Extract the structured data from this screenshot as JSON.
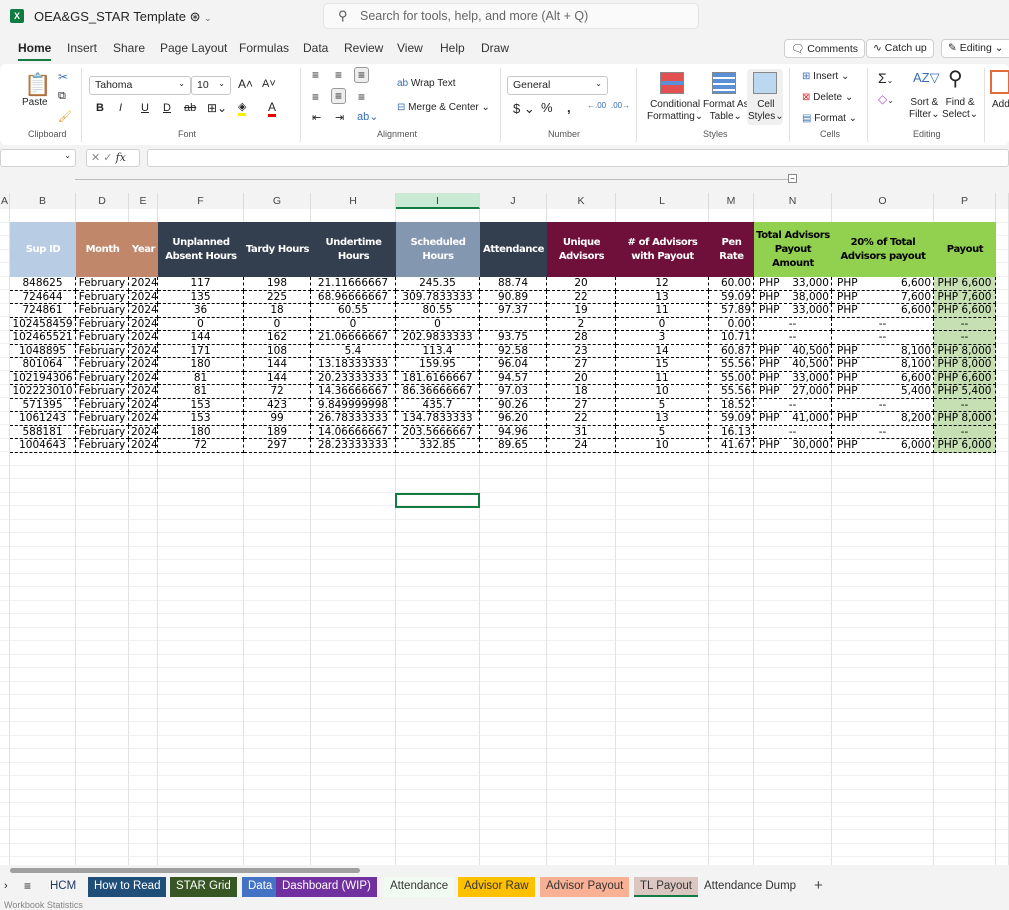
{
  "app": {
    "doc_title": "OEA&GS_STAR Template",
    "search_placeholder": "Search for tools, help, and more (Alt + Q)"
  },
  "menu_tabs": [
    "Home",
    "Insert",
    "Share",
    "Page Layout",
    "Formulas",
    "Data",
    "Review",
    "View",
    "Help",
    "Draw"
  ],
  "top_buttons": {
    "comments": "Comments",
    "catch_up": "Catch up",
    "editing": "Editing"
  },
  "ribbon": {
    "paste": "Paste",
    "clipboard": "Clipboard",
    "font_name": "Tahoma",
    "font_size": "10",
    "font": "Font",
    "wrap_text": "Wrap Text",
    "merge_center": "Merge & Center",
    "alignment": "Alignment",
    "number_format": "General",
    "number": "Number",
    "conditional": "Conditional",
    "formatting": "Formatting",
    "format_as": "Format As",
    "table": "Table",
    "cell": "Cell",
    "styles_btn": "Styles",
    "styles": "Styles",
    "insert": "Insert",
    "delete": "Delete",
    "format": "Format",
    "cells": "Cells",
    "sort": "Sort &",
    "filter": "Filter",
    "find": "Find &",
    "select": "Select",
    "editing": "Editing",
    "add": "Add"
  },
  "formula_bar": {
    "fx": "fx",
    "value": ""
  },
  "columns": [
    "A",
    "B",
    "D",
    "E",
    "F",
    "G",
    "H",
    "I",
    "J",
    "K",
    "L",
    "M",
    "N",
    "O",
    "P"
  ],
  "headers": [
    "Sup ID",
    "Month",
    "Year",
    "Unplanned Absent Hours",
    "Tardy Hours",
    "Undertime Hours",
    "Scheduled Hours",
    "Attendance",
    "Unique Advisors",
    "# of Advisors with Payout",
    "Pen Rate",
    "Total Advisors Payout Amount",
    "20% of Total Advisors payout",
    "Payout"
  ],
  "header_colors": [
    "#b8cce4",
    "#c0876a",
    "#c0876a",
    "#333f4f",
    "#333f4f",
    "#333f4f",
    "#8497b0",
    "#333f4f",
    "#6e1039",
    "#6e1039",
    "#6e1039",
    "#92d050",
    "#92d050",
    "#92d050"
  ],
  "rows": [
    [
      "848625",
      "February",
      "2024",
      "117",
      "198",
      "21.11666667",
      "245.35",
      "88.74",
      "20",
      "12",
      "60.00",
      "33,000",
      "6,600",
      "PHP 6,600"
    ],
    [
      "724644",
      "February",
      "2024",
      "135",
      "225",
      "68.96666667",
      "309.7833333",
      "90.89",
      "22",
      "13",
      "59.09",
      "38,000",
      "7,600",
      "PHP 7,600"
    ],
    [
      "724861",
      "February",
      "2024",
      "36",
      "18",
      "60.55",
      "80.55",
      "97.37",
      "19",
      "11",
      "57.89",
      "33,000",
      "6,600",
      "PHP 6,600"
    ],
    [
      "102458459",
      "February",
      "2024",
      "0",
      "0",
      "0",
      "0",
      "",
      "2",
      "0",
      "0.00",
      "--",
      "--",
      "--"
    ],
    [
      "102465521",
      "February",
      "2024",
      "144",
      "162",
      "21.06666667",
      "202.9833333",
      "93.75",
      "28",
      "3",
      "10.71",
      "--",
      "--",
      "--"
    ],
    [
      "1048895",
      "February",
      "2024",
      "171",
      "108",
      "5.4",
      "113.4",
      "92.58",
      "23",
      "14",
      "60.87",
      "40,500",
      "8,100",
      "PHP 8,000"
    ],
    [
      "801064",
      "February",
      "2024",
      "180",
      "144",
      "13.18333333",
      "159.95",
      "96.04",
      "27",
      "15",
      "55.56",
      "40,500",
      "8,100",
      "PHP 8,000"
    ],
    [
      "102194306",
      "February",
      "2024",
      "81",
      "144",
      "20.23333333",
      "181.6166667",
      "94.57",
      "20",
      "11",
      "55.00",
      "33,000",
      "6,600",
      "PHP 6,600"
    ],
    [
      "102223010",
      "February",
      "2024",
      "81",
      "72",
      "14.36666667",
      "86.36666667",
      "97.03",
      "18",
      "10",
      "55.56",
      "27,000",
      "5,400",
      "PHP 5,400"
    ],
    [
      "571395",
      "February",
      "2024",
      "153",
      "423",
      "9.849999998",
      "435.7",
      "90.26",
      "27",
      "5",
      "18.52",
      "--",
      "--",
      "--"
    ],
    [
      "1061243",
      "February",
      "2024",
      "153",
      "99",
      "26.78333333",
      "134.7833333",
      "96.20",
      "22",
      "13",
      "59.09",
      "41,000",
      "8,200",
      "PHP 8,000"
    ],
    [
      "588181",
      "February",
      "2024",
      "180",
      "189",
      "14.06666667",
      "203.5666667",
      "94.96",
      "31",
      "5",
      "16.13",
      "--",
      "--",
      "--"
    ],
    [
      "1004643",
      "February",
      "2024",
      "72",
      "297",
      "28.23333333",
      "332.85",
      "89.65",
      "24",
      "10",
      "41.67",
      "30,000",
      "6,000",
      "PHP 6,000"
    ]
  ],
  "currency": "PHP",
  "sheet_tabs": [
    {
      "label": "HCM",
      "bg": "transparent",
      "fg": "#1f3864"
    },
    {
      "label": "How to Read",
      "bg": "#1f4e79",
      "fg": "#ffffff"
    },
    {
      "label": "STAR Grid",
      "bg": "#375623",
      "fg": "#ffffff"
    },
    {
      "label": "Data",
      "bg": "#4472c4",
      "fg": "#ffffff"
    },
    {
      "label": "Dashboard (WIP)",
      "bg": "#7030a0",
      "fg": "#ffffff"
    },
    {
      "label": "Attendance",
      "bg": "#f2fbf2",
      "fg": "#333333"
    },
    {
      "label": "Advisor Raw",
      "bg": "#ffc000",
      "fg": "#333333"
    },
    {
      "label": "Advisor Payout",
      "bg": "#f8b195",
      "fg": "#333333"
    },
    {
      "label": "TL Payout",
      "bg": "#dcc6c2",
      "fg": "#333333"
    },
    {
      "label": "Attendance Dump",
      "bg": "transparent",
      "fg": "#333333"
    }
  ],
  "status": "Workbook Statistics"
}
